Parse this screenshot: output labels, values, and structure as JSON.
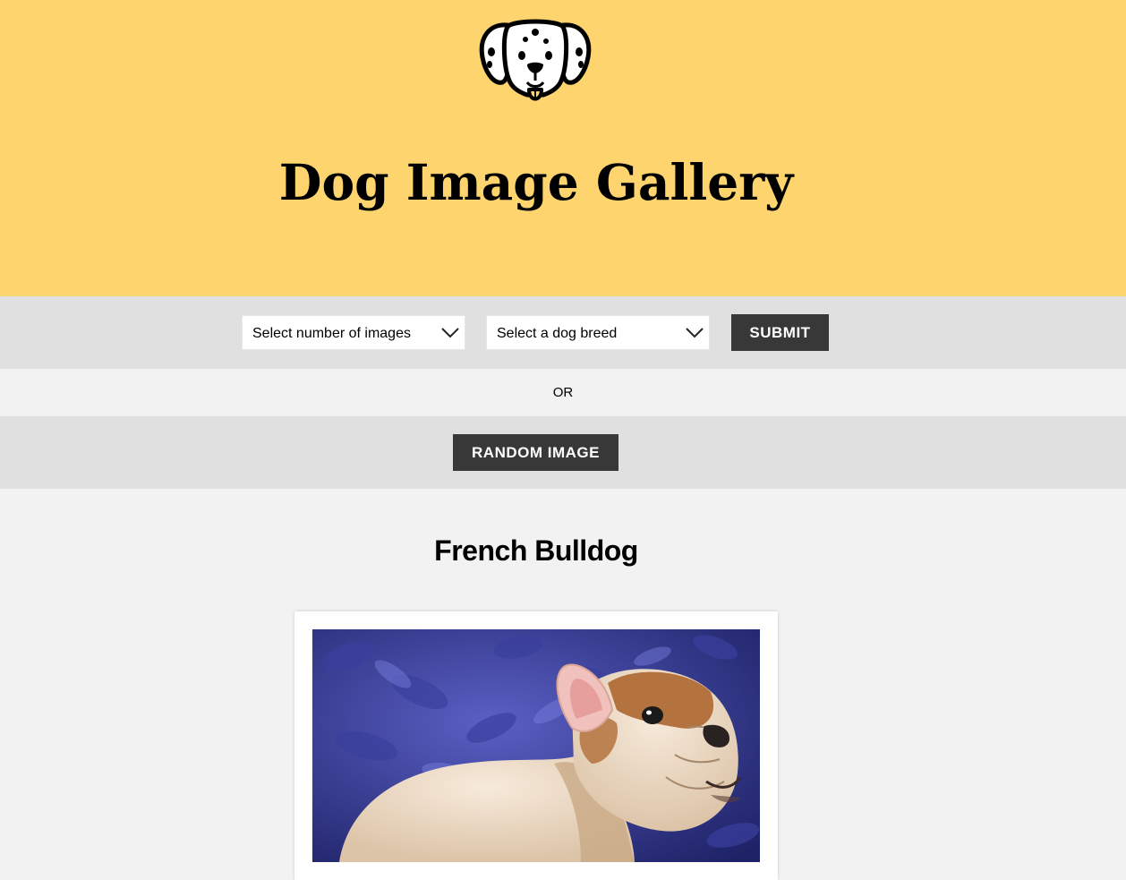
{
  "header": {
    "title": "Dog Image Gallery",
    "logo_icon": "dalmatian-face-icon",
    "background_color": "#fed46e"
  },
  "form": {
    "number_select": {
      "selected": "Select number of images"
    },
    "breed_select": {
      "selected": "Select a dog breed"
    },
    "submit_label": "SUBMIT"
  },
  "divider": {
    "or_text": "OR"
  },
  "random": {
    "button_label": "RANDOM IMAGE"
  },
  "gallery": {
    "breed_title": "French Bulldog",
    "photo_alt": "French Bulldog puppy"
  },
  "colors": {
    "accent_yellow": "#fed46e",
    "button_dark": "#383838",
    "bar_gray": "#e0e0e0",
    "page_bg": "#f2f2f2"
  }
}
